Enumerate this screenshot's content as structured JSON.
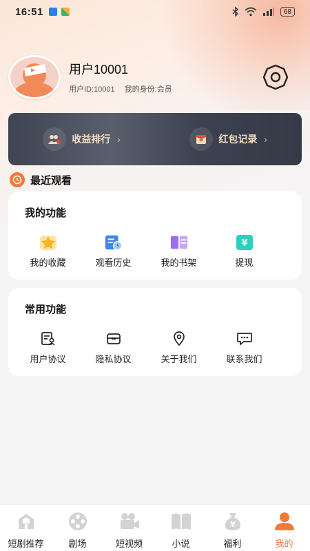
{
  "status_bar": {
    "time": "16:51",
    "battery": "68"
  },
  "profile": {
    "username": "用户10001",
    "user_id": "用户ID:10001",
    "identity": "我的身份:会员"
  },
  "dark_card": {
    "items": [
      {
        "label": "收益排行"
      },
      {
        "label": "红包记录"
      }
    ]
  },
  "recent": {
    "label": "最近观看"
  },
  "my_functions": {
    "title": "我的功能",
    "items": [
      {
        "label": "我的收藏",
        "icon": "star-icon"
      },
      {
        "label": "观看历史",
        "icon": "history-icon"
      },
      {
        "label": "我的书架",
        "icon": "bookshelf-icon"
      },
      {
        "label": "提现",
        "icon": "withdraw-icon"
      }
    ]
  },
  "common_functions": {
    "title": "常用功能",
    "items": [
      {
        "label": "用户协议",
        "icon": "user-agreement-icon"
      },
      {
        "label": "隐私协议",
        "icon": "privacy-icon"
      },
      {
        "label": "关于我们",
        "icon": "location-pin-icon"
      },
      {
        "label": "联系我们",
        "icon": "chat-icon"
      }
    ]
  },
  "bottom_nav": {
    "items": [
      {
        "label": "短剧推荐",
        "icon": "house-icon"
      },
      {
        "label": "剧场",
        "icon": "film-reel-icon"
      },
      {
        "label": "短视频",
        "icon": "video-camera-icon"
      },
      {
        "label": "小说",
        "icon": "book-icon"
      },
      {
        "label": "福利",
        "icon": "money-bag-icon"
      },
      {
        "label": "我的",
        "icon": "person-icon",
        "active": true
      }
    ]
  },
  "colors": {
    "accent": "#f07a3a",
    "gold_text": "#f3dcc0",
    "dark_card": "#41465a"
  }
}
